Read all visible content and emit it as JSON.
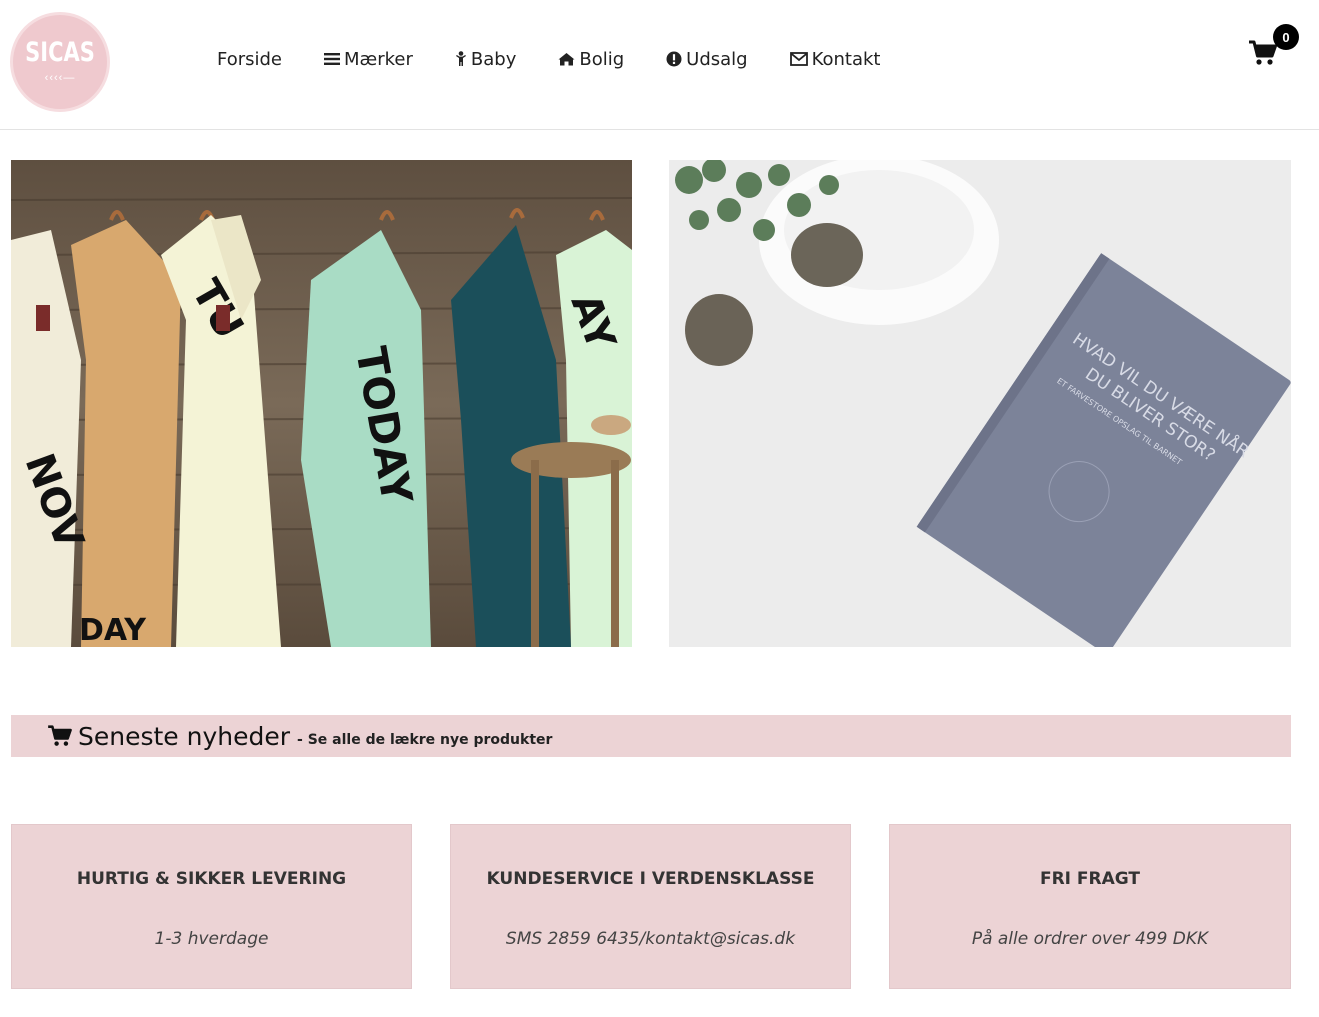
{
  "logo": {
    "text": "SICAS"
  },
  "nav": {
    "items": [
      {
        "label": "Forside",
        "icon": ""
      },
      {
        "label": "Mærker",
        "icon": "bars-icon"
      },
      {
        "label": "Baby",
        "icon": "child-icon"
      },
      {
        "label": "Bolig",
        "icon": "home-icon"
      },
      {
        "label": "Udsalg",
        "icon": "exclamation-circle-icon"
      },
      {
        "label": "Kontakt",
        "icon": "envelope-icon"
      }
    ]
  },
  "cart": {
    "count": "0",
    "icon": "shopping-cart-icon"
  },
  "hero": {
    "left": {
      "image": "tea-towels-photo"
    },
    "right": {
      "image": "book-photo"
    }
  },
  "banner": {
    "icon": "shopping-cart-icon",
    "title": "Seneste nyheder",
    "subtitle": "- Se alle de lækre nye produkter"
  },
  "features": [
    {
      "title": "HURTIG & SIKKER LEVERING",
      "subtitle": "1-3 hverdage"
    },
    {
      "title": "KUNDESERVICE I VERDENSKLASSE",
      "subtitle": "SMS 2859 6435/kontakt@sicas.dk"
    },
    {
      "title": "FRI FRAGT",
      "subtitle": "På alle ordrer over 499 DKK"
    }
  ],
  "colors": {
    "accent_pink": "#ecd3d5",
    "logo_pink": "#efc9ce",
    "text_dark": "#222222",
    "badge": "#000000"
  }
}
